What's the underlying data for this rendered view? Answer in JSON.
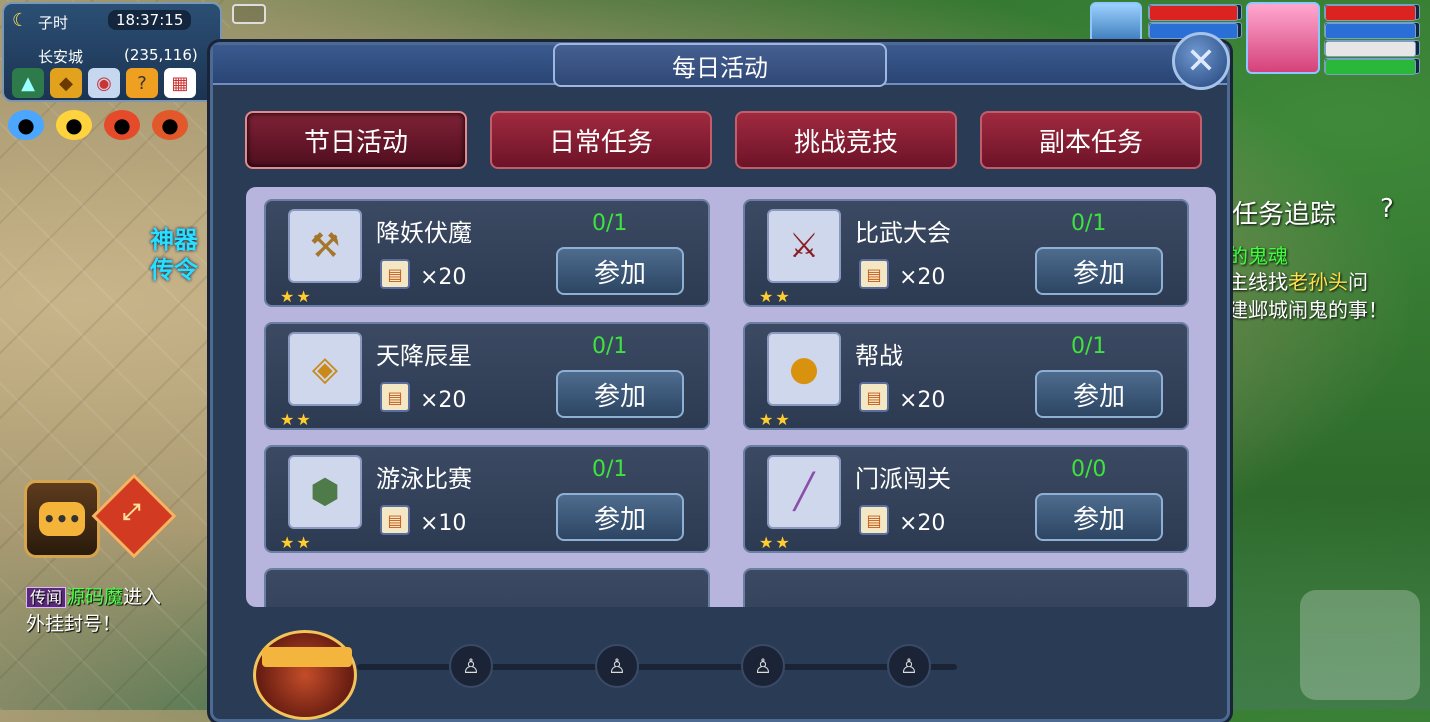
{
  "hud": {
    "moon_icon": "moon-icon",
    "time_period": "子时",
    "clock": "18:37:15",
    "city": "长安城",
    "coords": "(235,116)",
    "side_text": [
      "神器",
      "传令"
    ]
  },
  "dialog": {
    "title": "每日活动",
    "close_label": "✕",
    "tabs": [
      {
        "label": "节日活动",
        "active": true
      },
      {
        "label": "日常任务",
        "active": false
      },
      {
        "label": "挑战竞技",
        "active": false
      },
      {
        "label": "副本任务",
        "active": false
      }
    ],
    "activities": [
      {
        "name": "降妖伏魔",
        "progress": "0/1",
        "reward_count": "×20",
        "join": "参加",
        "stars": "★★",
        "icon": "broom-icon"
      },
      {
        "name": "比武大会",
        "progress": "0/1",
        "reward_count": "×20",
        "join": "参加",
        "stars": "★★",
        "icon": "sword-icon"
      },
      {
        "name": "天降辰星",
        "progress": "0/1",
        "reward_count": "×20",
        "join": "参加",
        "stars": "★★",
        "icon": "treasure-box-icon"
      },
      {
        "name": "帮战",
        "progress": "0/1",
        "reward_count": "×20",
        "join": "参加",
        "stars": "★★",
        "icon": "drum-icon"
      },
      {
        "name": "游泳比赛",
        "progress": "0/1",
        "reward_count": "×10",
        "join": "参加",
        "stars": "★★",
        "icon": "turtle-shell-icon"
      },
      {
        "name": "门派闯关",
        "progress": "0/0",
        "reward_count": "×20",
        "join": "参加",
        "stars": "★★",
        "icon": "flute-icon"
      }
    ]
  },
  "chat": {
    "tag": "传闻",
    "sender": "源码魔",
    "text1": "进入",
    "text2": "外挂封号！"
  },
  "quest": {
    "title": "任务追踪",
    "help": "?",
    "line1": "的鬼魂",
    "line2_a": "主线",
    "line2_b": "找",
    "line2_npc": "老孙头",
    "line2_c": "问",
    "line3": "建邺城闹鬼的事！"
  }
}
